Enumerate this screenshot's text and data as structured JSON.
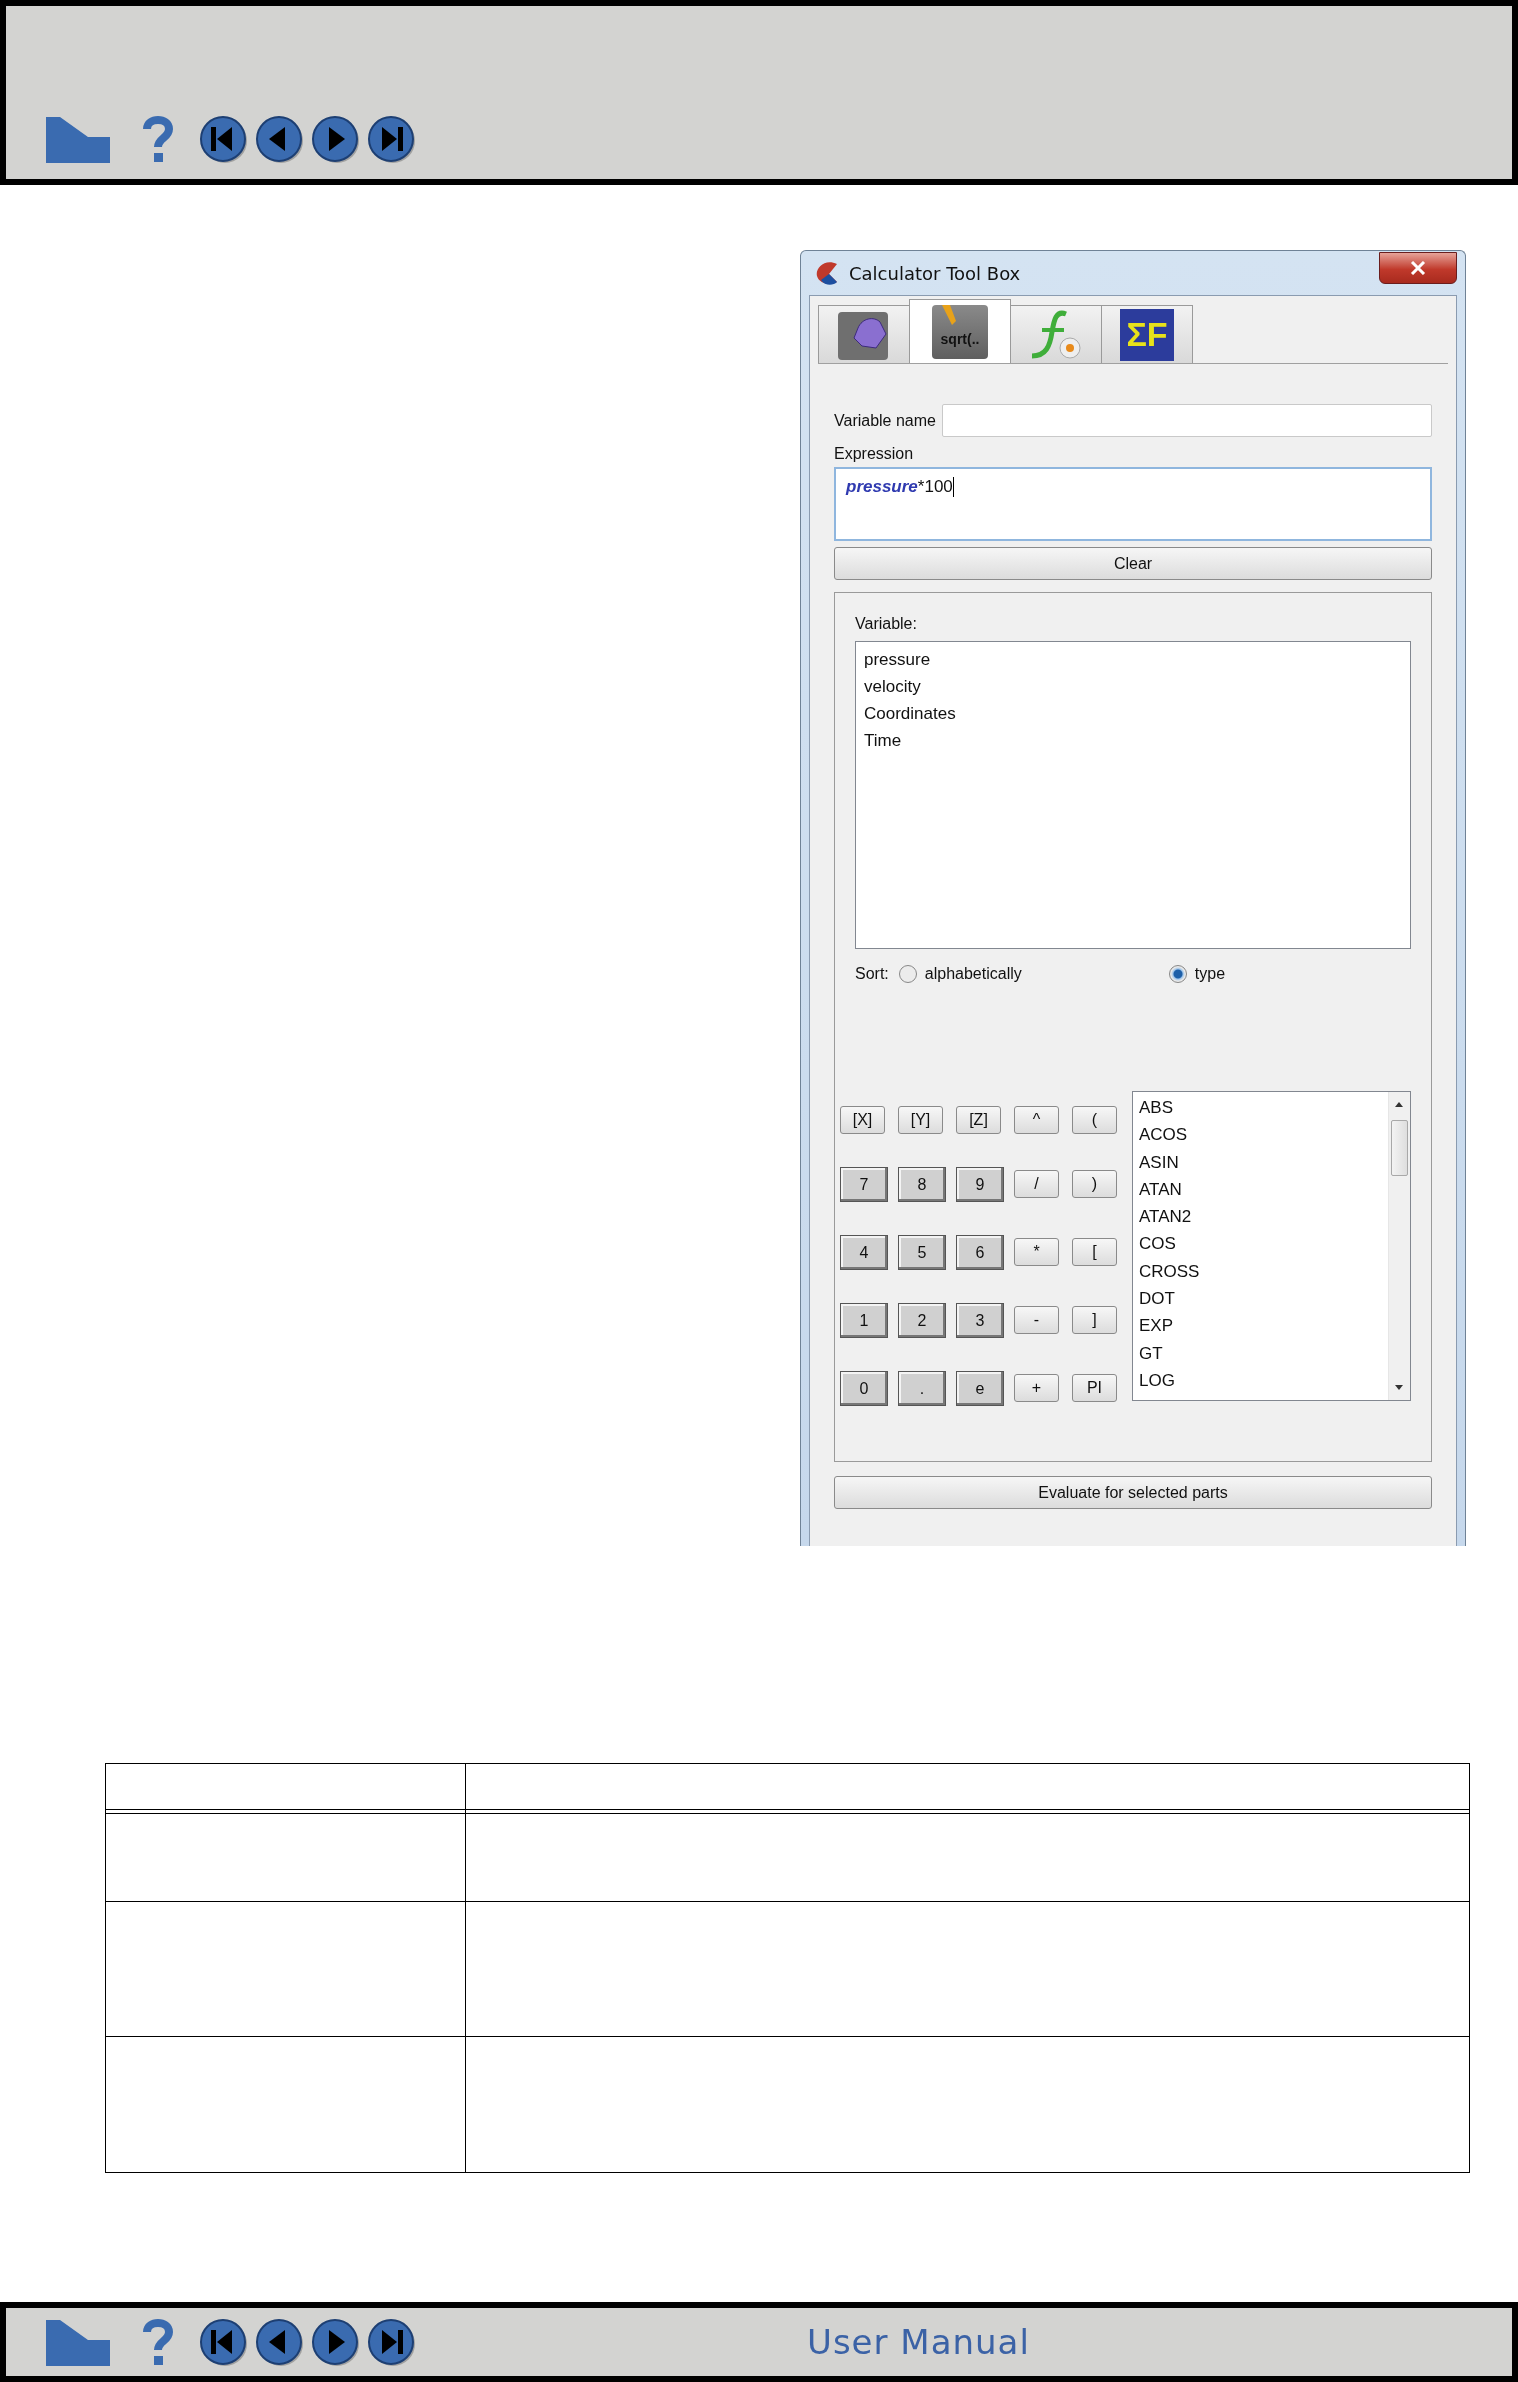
{
  "header": {
    "buttons": [
      {
        "kind": "home"
      },
      {
        "kind": "help"
      },
      {
        "kind": "first"
      },
      {
        "kind": "previous"
      },
      {
        "kind": "next"
      },
      {
        "kind": "last"
      }
    ]
  },
  "dialog": {
    "title": "Calculator Tool Box",
    "tabs": [
      {
        "kind": "formula",
        "selected": false
      },
      {
        "kind": "sqrt",
        "label": "sqrt(..",
        "selected": true
      },
      {
        "kind": "function",
        "selected": false
      },
      {
        "kind": "sum",
        "label": "ΣF",
        "selected": false
      }
    ],
    "variable_name": {
      "label": "Variable name"
    },
    "expression": {
      "label": "Expression",
      "parts": [
        {
          "kind": "variable",
          "text": "pressure"
        },
        {
          "kind": "plain",
          "text": "*100"
        }
      ]
    },
    "clear_button": "Clear",
    "variables": {
      "label": "Variable:",
      "items": [
        "pressure",
        "velocity",
        "Coordinates",
        "Time"
      ]
    },
    "sort": {
      "label": "Sort:",
      "options": [
        {
          "label": "alphabetically",
          "selected": false
        },
        {
          "label": "type",
          "selected": true
        }
      ]
    },
    "keypad": [
      [
        {
          "label": "[X]",
          "kind": "operator"
        },
        {
          "label": "[Y]",
          "kind": "operator"
        },
        {
          "label": "[Z]",
          "kind": "operator"
        },
        {
          "label": "^",
          "kind": "operator"
        },
        {
          "label": "(",
          "kind": "operator"
        }
      ],
      [
        {
          "label": "7",
          "kind": "digit"
        },
        {
          "label": "8",
          "kind": "digit"
        },
        {
          "label": "9",
          "kind": "digit"
        },
        {
          "label": "/",
          "kind": "operator"
        },
        {
          "label": ")",
          "kind": "operator"
        }
      ],
      [
        {
          "label": "4",
          "kind": "digit"
        },
        {
          "label": "5",
          "kind": "digit"
        },
        {
          "label": "6",
          "kind": "digit"
        },
        {
          "label": "*",
          "kind": "operator"
        },
        {
          "label": "[",
          "kind": "operator"
        }
      ],
      [
        {
          "label": "1",
          "kind": "digit"
        },
        {
          "label": "2",
          "kind": "digit"
        },
        {
          "label": "3",
          "kind": "digit"
        },
        {
          "label": "-",
          "kind": "operator"
        },
        {
          "label": "]",
          "kind": "operator"
        }
      ],
      [
        {
          "label": "0",
          "kind": "digit"
        },
        {
          "label": ".",
          "kind": "digit"
        },
        {
          "label": "e",
          "kind": "digit"
        },
        {
          "label": "+",
          "kind": "operator"
        },
        {
          "label": "PI",
          "kind": "operator"
        }
      ]
    ],
    "functions": [
      "ABS",
      "ACOS",
      "ASIN",
      "ATAN",
      "ATAN2",
      "COS",
      "CROSS",
      "DOT",
      "EXP",
      "GT",
      "LOG"
    ],
    "evaluate_button": "Evaluate for selected parts"
  },
  "footer": {
    "buttons": [
      {
        "kind": "home"
      },
      {
        "kind": "help"
      },
      {
        "kind": "first"
      },
      {
        "kind": "previous"
      },
      {
        "kind": "next"
      },
      {
        "kind": "last"
      }
    ],
    "title": "User Manual"
  }
}
